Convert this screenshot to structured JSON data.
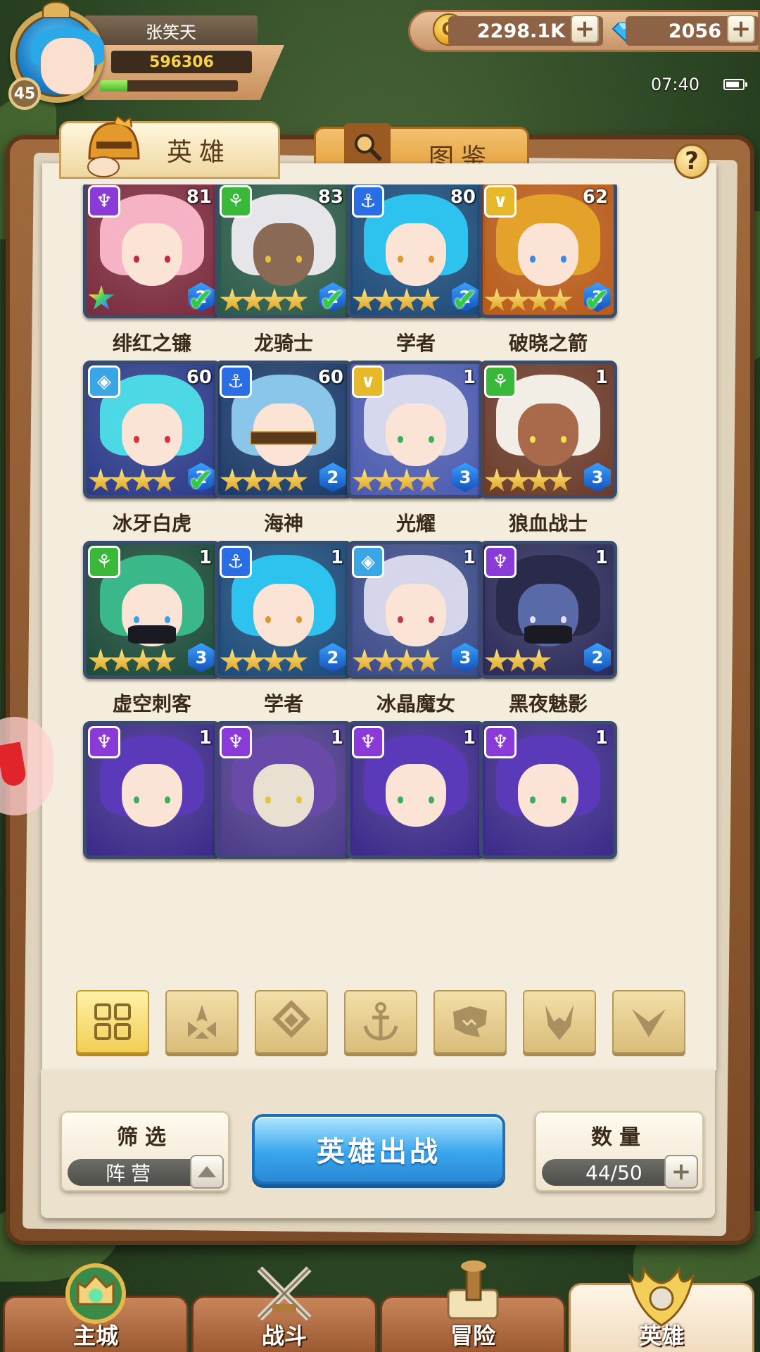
{
  "player": {
    "name": "张笑天",
    "level": "45",
    "power": "596306",
    "exp_fraction": 0.2
  },
  "resources": {
    "gold": "2298.1K",
    "gems": "2056"
  },
  "status": {
    "time": "07:40"
  },
  "tabs": [
    {
      "label": "英雄",
      "active": true,
      "icon": "knight-helmet-icon"
    },
    {
      "label": "图鉴",
      "active": false,
      "icon": "magnifier-icon"
    }
  ],
  "heroes": [
    {
      "name": "绯红之镰",
      "level": "81",
      "faction": "demon",
      "stars": 0,
      "rainbow_star": true,
      "rank": "2",
      "check": true,
      "hair": "#f6b3c6",
      "bg": "#7a2a3e",
      "eye": "#c22a3a"
    },
    {
      "name": "龙骑士",
      "level": "83",
      "faction": "beast",
      "stars": 4,
      "rank": "2",
      "check": true,
      "hair": "#e6e6ea",
      "bg": "#2a5a4a",
      "eye": "#e6c23a",
      "skin": "#8a6a55"
    },
    {
      "name": "学者",
      "level": "80",
      "faction": "ocean",
      "stars": 4,
      "rank": "2",
      "check": true,
      "hair": "#2ec3ee",
      "bg": "#1a4a7a",
      "eye": "#e0962a"
    },
    {
      "name": "破晓之箭",
      "level": "62",
      "faction": "light",
      "stars": 4,
      "rank": "3",
      "check": true,
      "hair": "#e5a22a",
      "bg": "#b85a1a",
      "eye": "#3a8ae6"
    },
    {
      "name": "冰牙白虎",
      "level": "60",
      "faction": "ice",
      "stars": 4,
      "rank": "2",
      "check": true,
      "hair": "#4dd8e6",
      "bg": "#2a3a8a",
      "eye": "#e02a3a"
    },
    {
      "name": "海神",
      "level": "60",
      "faction": "ocean",
      "stars": 4,
      "rank": "2",
      "check": false,
      "hair": "#8ac6ea",
      "bg": "#1a3a6a",
      "eye": "#2a1a0a",
      "blindfold": true
    },
    {
      "name": "光耀",
      "level": "1",
      "faction": "light",
      "stars": 4,
      "rank": "3",
      "check": false,
      "hair": "#d6d8ee",
      "bg": "#4a5ab0",
      "eye": "#3ab05a"
    },
    {
      "name": "狼血战士",
      "level": "1",
      "faction": "beast",
      "stars": 4,
      "rank": "3",
      "check": false,
      "hair": "#f2eee6",
      "bg": "#6a3a2a",
      "eye": "#f0e04a",
      "skin": "#a86a4a"
    },
    {
      "name": "虚空刺客",
      "level": "1",
      "faction": "beast",
      "stars": 4,
      "rank": "3",
      "check": false,
      "hair": "#3ab88a",
      "bg": "#1a4a3a",
      "eye": "#3aa0e6",
      "mask": true
    },
    {
      "name": "学者",
      "level": "1",
      "faction": "ocean",
      "stars": 4,
      "rank": "2",
      "check": false,
      "hair": "#2ec3ee",
      "bg": "#1a4a7a",
      "eye": "#e0962a"
    },
    {
      "name": "冰晶魔女",
      "level": "1",
      "faction": "ice",
      "stars": 4,
      "rank": "3",
      "check": false,
      "hair": "#d6d6ea",
      "bg": "#3a4a8a",
      "eye": "#c23a4a"
    },
    {
      "name": "黑夜魅影",
      "level": "1",
      "faction": "demon",
      "stars": 3,
      "rank": "2",
      "check": false,
      "hair": "#2a2a4a",
      "bg": "#2a2a5a",
      "eye": "#e0e0ff",
      "skin": "#5a6aa8",
      "mask": true
    },
    {
      "name": "",
      "level": "1",
      "faction": "demon",
      "stars": 0,
      "rank": "",
      "check": false,
      "hair": "#5a3ab8",
      "bg": "#3a2a8a",
      "eye": "#3ab05a"
    },
    {
      "name": "",
      "level": "1",
      "faction": "demon",
      "stars": 0,
      "rank": "",
      "check": false,
      "hair": "#6a4aa8",
      "bg": "#4a3a8a",
      "eye": "#e6c23a",
      "skin": "#e8e0d0"
    },
    {
      "name": "",
      "level": "1",
      "faction": "demon",
      "stars": 0,
      "rank": "",
      "check": false,
      "hair": "#5a3ab8",
      "bg": "#3a2a8a",
      "eye": "#3ab05a"
    },
    {
      "name": "",
      "level": "1",
      "faction": "demon",
      "stars": 0,
      "rank": "",
      "check": false,
      "hair": "#5a3ab8",
      "bg": "#3a2a8a",
      "eye": "#3ab05a"
    }
  ],
  "faction_filters": [
    {
      "icon": "all-grid-icon",
      "active": true
    },
    {
      "icon": "forest-faction-icon",
      "active": false
    },
    {
      "icon": "ice-faction-icon",
      "active": false
    },
    {
      "icon": "ocean-anchor-icon",
      "active": false
    },
    {
      "icon": "beast-faction-icon",
      "active": false
    },
    {
      "icon": "demon-faction-icon",
      "active": false
    },
    {
      "icon": "light-faction-icon",
      "active": false
    }
  ],
  "filter_box": {
    "title": "筛选",
    "value": "阵营"
  },
  "deploy_button": "英雄出战",
  "count_box": {
    "title": "数量",
    "value": "44/50"
  },
  "nav": [
    {
      "label": "主城",
      "icon": "castle-icon",
      "active": false
    },
    {
      "label": "战斗",
      "icon": "crossed-swords-icon",
      "active": false
    },
    {
      "label": "冒险",
      "icon": "map-scroll-icon",
      "active": false
    },
    {
      "label": "英雄",
      "icon": "hero-crest-icon",
      "active": true
    }
  ],
  "colors": {
    "demon": "#8a3ad6",
    "beast": "#3ab83a",
    "ocean": "#2a6ee6",
    "light": "#e6b82a",
    "ice": "#3aa6e6"
  }
}
